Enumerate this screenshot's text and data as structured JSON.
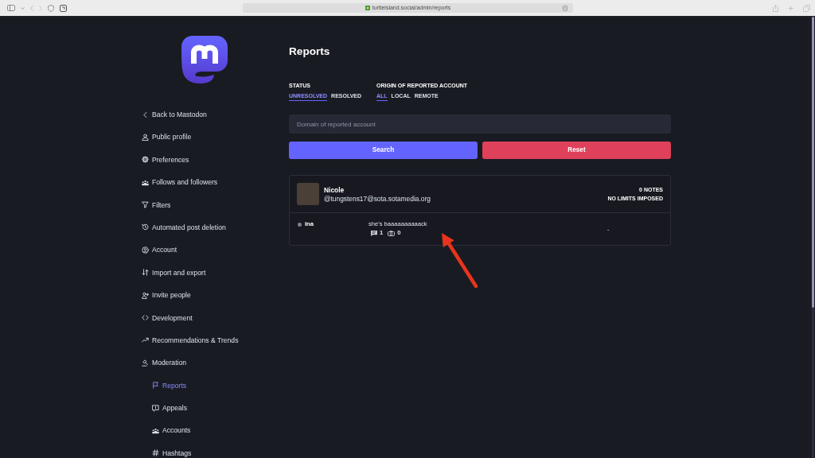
{
  "browser": {
    "url": "turtleisland.social/admin/reports"
  },
  "sidebar": {
    "items": [
      {
        "label": "Back to Mastodon",
        "selected": false
      },
      {
        "label": "Public profile",
        "selected": false
      },
      {
        "label": "Preferences",
        "selected": false
      },
      {
        "label": "Follows and followers",
        "selected": false
      },
      {
        "label": "Filters",
        "selected": false
      },
      {
        "label": "Automated post deletion",
        "selected": false
      },
      {
        "label": "Account",
        "selected": false
      },
      {
        "label": "Import and export",
        "selected": false
      },
      {
        "label": "Invite people",
        "selected": false
      },
      {
        "label": "Development",
        "selected": false
      },
      {
        "label": "Recommendations & Trends",
        "selected": false
      },
      {
        "label": "Moderation",
        "selected": false,
        "children": [
          {
            "label": "Reports",
            "selected": true
          },
          {
            "label": "Appeals",
            "selected": false
          },
          {
            "label": "Accounts",
            "selected": false
          },
          {
            "label": "Hashtags",
            "selected": false
          }
        ]
      }
    ]
  },
  "page": {
    "title": "Reports",
    "filters": [
      {
        "label": "STATUS",
        "options": [
          {
            "label": "UNRESOLVED",
            "selected": true
          },
          {
            "label": "RESOLVED",
            "selected": false
          }
        ]
      },
      {
        "label": "ORIGIN OF REPORTED ACCOUNT",
        "options": [
          {
            "label": "ALL",
            "selected": true
          },
          {
            "label": "LOCAL",
            "selected": false
          },
          {
            "label": "REMOTE",
            "selected": false
          }
        ]
      }
    ],
    "search": {
      "placeholder": "Domain of reported account"
    },
    "buttons": [
      {
        "label": "Search",
        "kind": "primary"
      },
      {
        "label": "Reset",
        "kind": "danger"
      }
    ],
    "reports": [
      {
        "account": {
          "name": "Nicole",
          "handle": "@tungstens17@sota.sotamedia.org"
        },
        "notes": "0 NOTES",
        "limits": "NO LIMITS IMPOSED",
        "entries": [
          {
            "reporter": "ina",
            "comment": "she's baaaaaaaaaack",
            "statuses": "1",
            "media": "0",
            "column_4": "-"
          }
        ]
      }
    ]
  }
}
